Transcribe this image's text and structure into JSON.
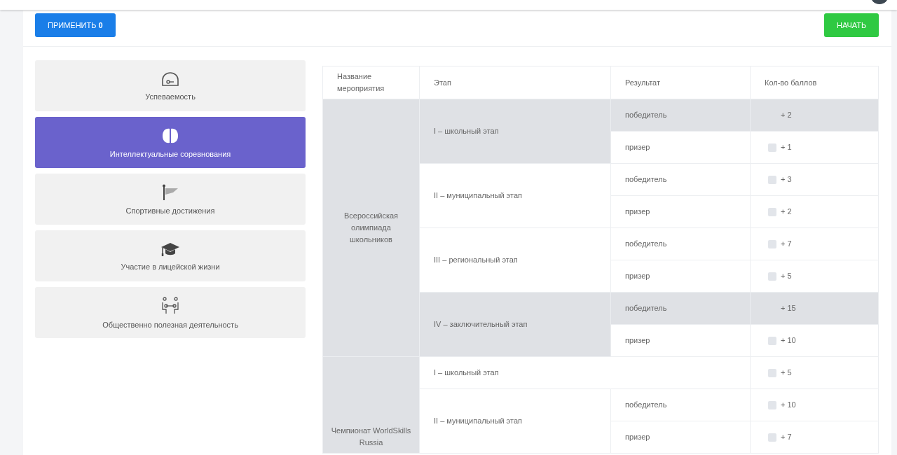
{
  "toolbar": {
    "apply_button": {
      "label": "ПРИМЕНИТЬ",
      "count": "0"
    },
    "start_button": {
      "label": "НАЧАТЬ"
    }
  },
  "sidebar": {
    "items": [
      {
        "label": "Успеваемость",
        "selected": false
      },
      {
        "label": "Интеллектуальные соревнования",
        "selected": true
      },
      {
        "label": "Спортивные достижения",
        "selected": false
      },
      {
        "label": "Участие в лицейской жизни",
        "selected": false
      },
      {
        "label": "Общественно полезная деятельность",
        "selected": false
      }
    ]
  },
  "table": {
    "columns": [
      "Название мероприятия",
      "Этап",
      "Результат",
      "Кол-во баллов"
    ],
    "events": [
      {
        "name": "Всероссийская олимпиада школьников",
        "highlighted": true,
        "stages": [
          {
            "name": "I – школьный этап",
            "results": [
              {
                "result": "победитель",
                "points": "+ 2",
                "selected": true
              },
              {
                "result": "призер",
                "points": "+ 1",
                "selected": false,
                "checked": false
              }
            ]
          },
          {
            "name": "II – муниципальный этап",
            "results": [
              {
                "result": "победитель",
                "points": "+ 3",
                "selected": false,
                "checked": false
              },
              {
                "result": "призер",
                "points": "+ 2",
                "selected": false,
                "checked": false
              }
            ]
          },
          {
            "name": "III – региональный этап",
            "results": [
              {
                "result": "победитель",
                "points": "+ 7",
                "selected": false,
                "checked": false
              },
              {
                "result": "призер",
                "points": "+ 5",
                "selected": false,
                "checked": false
              }
            ]
          },
          {
            "name": "IV – заключительный этап",
            "results": [
              {
                "result": "победитель",
                "points": "+ 15",
                "selected": true
              },
              {
                "result": "призер",
                "points": "+ 10",
                "selected": false,
                "checked": false
              }
            ]
          }
        ]
      },
      {
        "name": "Чемпионат WorldSkills Russia",
        "highlighted": true,
        "stages": [
          {
            "name": "I – школьный этап",
            "points": "+ 5",
            "selected": false,
            "checked": false
          },
          {
            "name": "II – муниципальный этап",
            "results": [
              {
                "result": "победитель",
                "points": "+ 10",
                "selected": false,
                "checked": false
              },
              {
                "result": "призер",
                "points": "+ 7",
                "selected": false,
                "checked": false
              }
            ]
          }
        ]
      }
    ]
  }
}
